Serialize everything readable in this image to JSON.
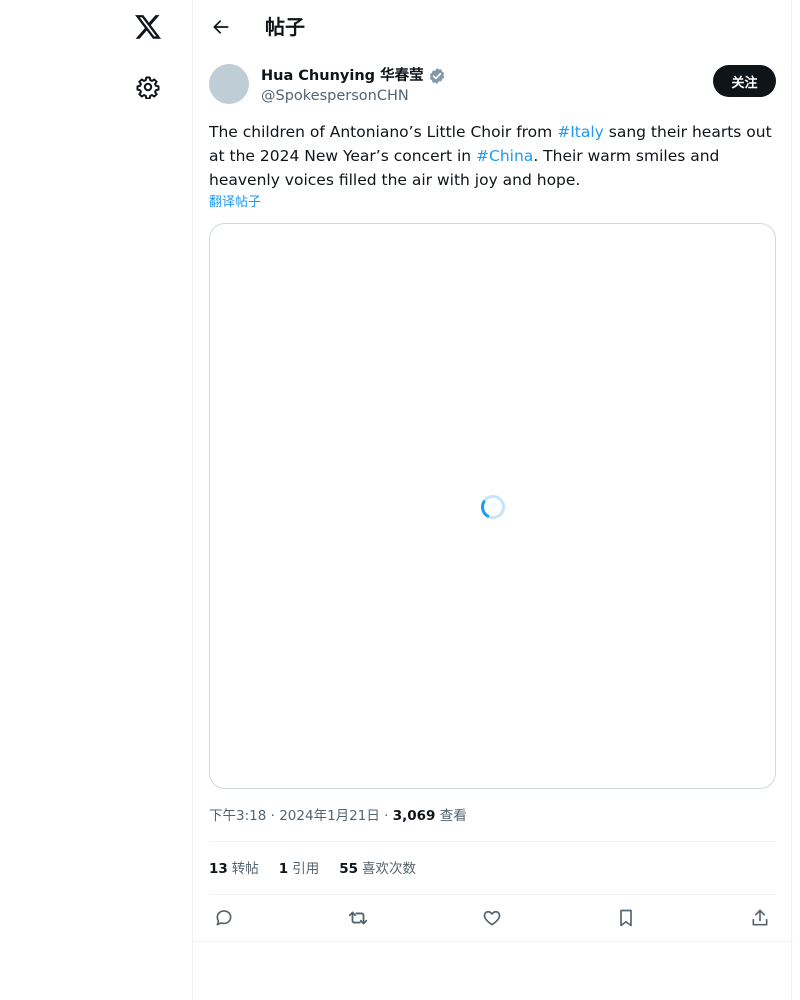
{
  "nav": {
    "logo_icon": "x-logo-icon",
    "settings_icon": "gear-icon"
  },
  "header": {
    "title": "帖子",
    "back_icon": "arrow-left-icon"
  },
  "author": {
    "name": "Hua Chunying 华春莹",
    "handle": "@SpokespersonCHN",
    "verified_color": "#829aab"
  },
  "follow_label": "关注",
  "post": {
    "text_part1": "The children of Antoniano’s Little Choir from ",
    "hashtag1": "#Italy",
    "text_part2": " sang their hearts out at the 2024 New Year’s concert in ",
    "hashtag2": "#China",
    "text_part3": ". Their warm smiles and heavenly voices filled the air with joy and hope.",
    "translate_label": "翻译帖子"
  },
  "meta": {
    "time": "下午3:18",
    "date": "2024年1月21日",
    "views_count": "3,069",
    "views_label": "查看"
  },
  "stats": [
    {
      "count": "13",
      "label": "转帖"
    },
    {
      "count": "1",
      "label": "引用"
    },
    {
      "count": "55",
      "label": "喜欢次数"
    }
  ],
  "colors": {
    "accent": "#1d9bf0",
    "text_primary": "#0f1419",
    "text_secondary": "#536471",
    "border": "#cfd9de"
  },
  "actions": [
    "reply-icon",
    "repost-icon",
    "like-icon",
    "bookmark-icon",
    "share-icon"
  ]
}
